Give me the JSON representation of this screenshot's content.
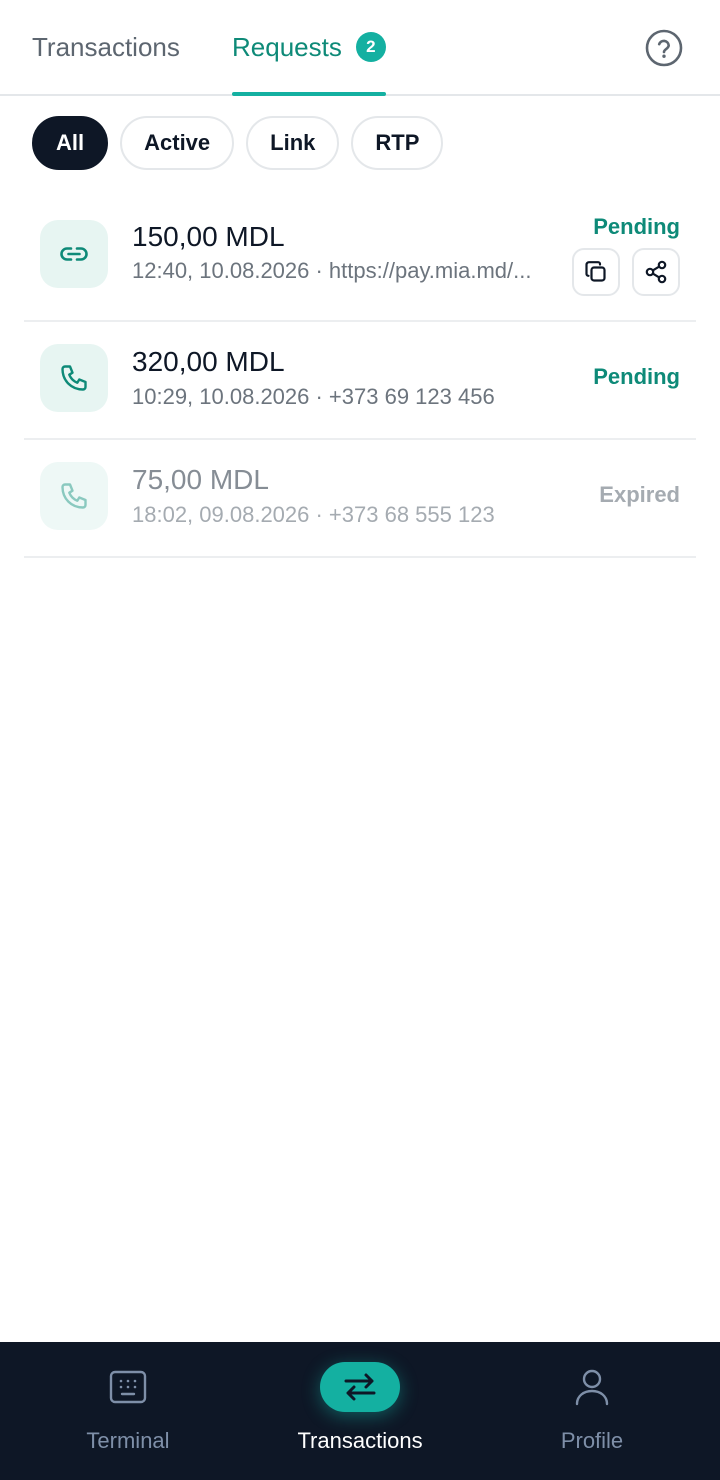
{
  "tabs": {
    "transactions_label": "Transactions",
    "requests_label": "Requests",
    "requests_badge": "2",
    "help_icon": "help-circle-icon"
  },
  "filters": {
    "all": "All",
    "active": "Active",
    "link": "Link",
    "rtp": "RTP",
    "selected": "All"
  },
  "requests": [
    {
      "icon": "link-icon",
      "amount": "150,00 MDL",
      "meta": "12:40, 10.08.2026 · https://pay.mia.md/...",
      "status": "Pending",
      "actions": [
        "copy-icon",
        "share-icon"
      ]
    },
    {
      "icon": "phone-icon",
      "amount": "320,00 MDL",
      "meta": "10:29, 10.08.2026 · +373 69 123 456",
      "status": "Pending"
    },
    {
      "icon": "phone-icon",
      "amount": "75,00 MDL",
      "meta": "18:02, 09.08.2026 · +373 68 555 123",
      "status": "Expired"
    }
  ],
  "bottom_nav": {
    "terminal": "Terminal",
    "transactions": "Transactions",
    "profile": "Profile",
    "active": "Transactions"
  },
  "colors": {
    "accent": "#14b0a1",
    "accent_text": "#0e8a78",
    "dark": "#0e1726",
    "expired": "#a5abb1"
  }
}
